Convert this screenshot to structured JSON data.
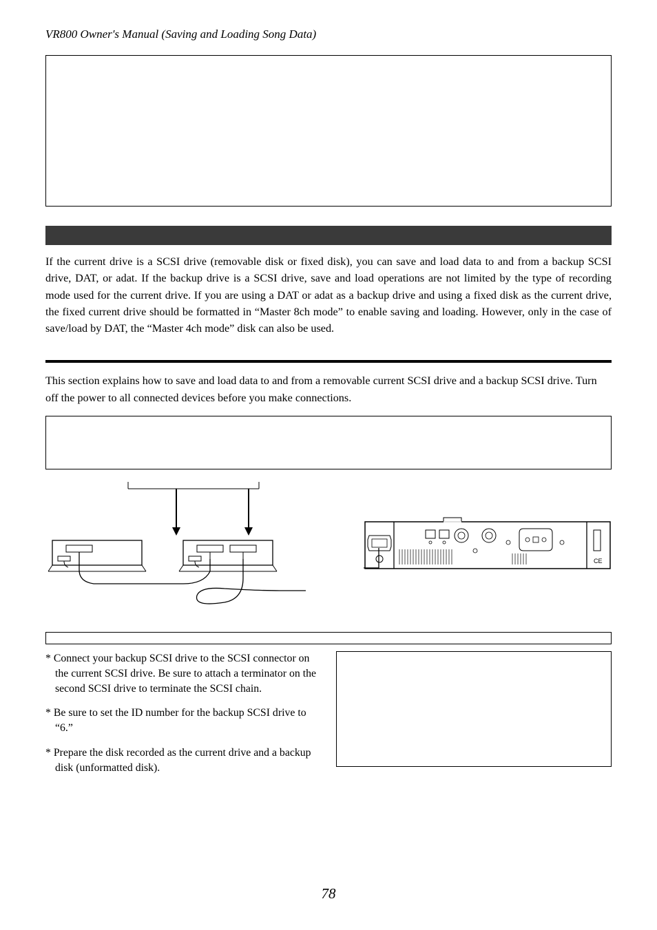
{
  "header": "VR800 Owner's Manual (Saving and Loading Song Data)",
  "intro": "If the current drive is a SCSI drive (removable disk or fixed disk), you can save and load data to and from a backup SCSI drive, DAT, or adat.  If the backup drive is a SCSI drive, save and load operations are not limited by the type of recording mode used for the current drive.  If you are using a DAT or adat as a backup drive and using a fixed disk as the current drive, the fixed current drive should be formatted in “Master 8ch mode” to enable saving and loading.  However, only in the case of save/load by DAT, the “Master 4ch mode” disk can also be used.",
  "section": "This section explains how to save and load data to and from a removable current SCSI drive and a backup SCSI drive.  Turn off the power to all connected devices before you make connections.",
  "bullets": {
    "b1": "*  Connect your backup SCSI drive to the SCSI connector on the current SCSI drive.  Be sure to attach a terminator on the second SCSI drive to terminate the SCSI chain.",
    "b2": "*  Be sure to set the ID number for the backup SCSI drive to “6.”",
    "b3": "*  Prepare the disk recorded as the current drive and a backup disk (unformatted disk)."
  },
  "pageNumber": "78"
}
